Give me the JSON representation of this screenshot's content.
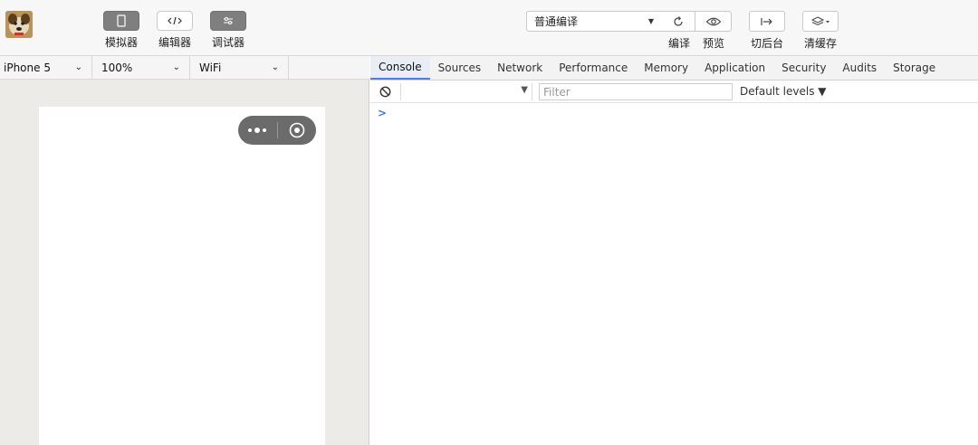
{
  "toolbar": {
    "tools": [
      {
        "name": "simulator",
        "label": "模拟器"
      },
      {
        "name": "editor",
        "label": "编辑器"
      },
      {
        "name": "debugger",
        "label": "调试器"
      }
    ],
    "compile_mode": "普通编译",
    "compile_label": "编译",
    "preview_label": "预览",
    "background_label": "切后台",
    "clear_cache_label": "清缓存"
  },
  "sim_bar": {
    "device": "iPhone 5",
    "zoom": "100%",
    "network": "WiFi"
  },
  "devtools": {
    "tabs": [
      "Console",
      "Sources",
      "Network",
      "Performance",
      "Memory",
      "Application",
      "Security",
      "Audits",
      "Storage"
    ],
    "active_tab": "Console",
    "filter_placeholder": "Filter",
    "levels_label": "Default levels ▼",
    "prompt_symbol": ">"
  },
  "colors": {
    "accent": "#4a84d6",
    "capsule": "#6b6b6b",
    "sim_background": "#edebe8"
  }
}
